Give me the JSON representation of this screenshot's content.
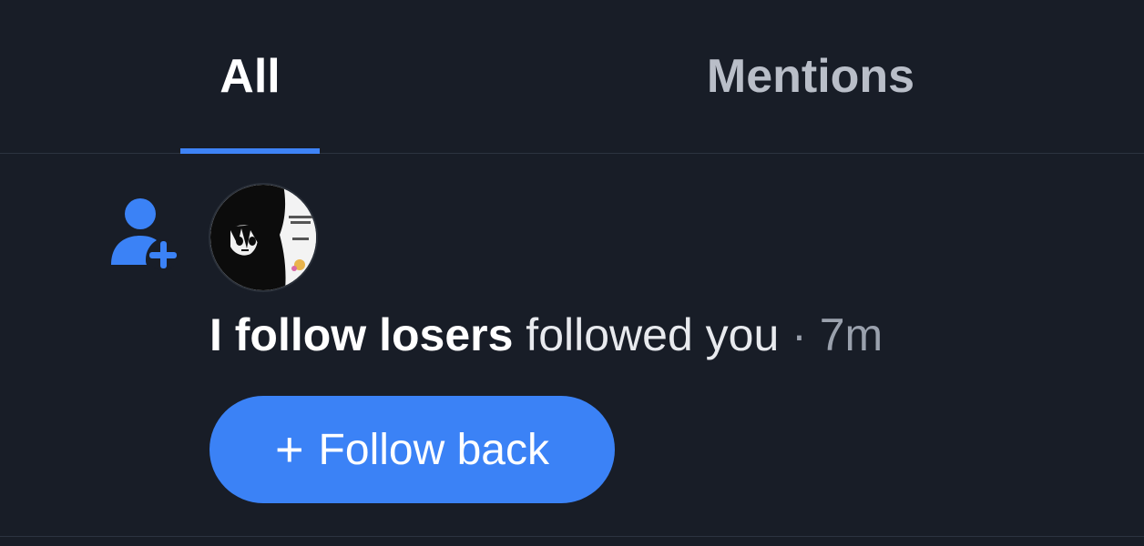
{
  "tabs": [
    {
      "label": "All",
      "active": true
    },
    {
      "label": "Mentions",
      "active": false
    }
  ],
  "notification": {
    "type_icon": "person-add-icon",
    "user_name": "I follow losers",
    "action": " followed you",
    "separator": " · ",
    "time": "7m",
    "button_icon": "+",
    "button_label": "Follow back"
  },
  "colors": {
    "background": "#181d27",
    "accent": "#3b82f6",
    "text_primary": "#ffffff",
    "text_secondary": "#9aa1ad"
  }
}
